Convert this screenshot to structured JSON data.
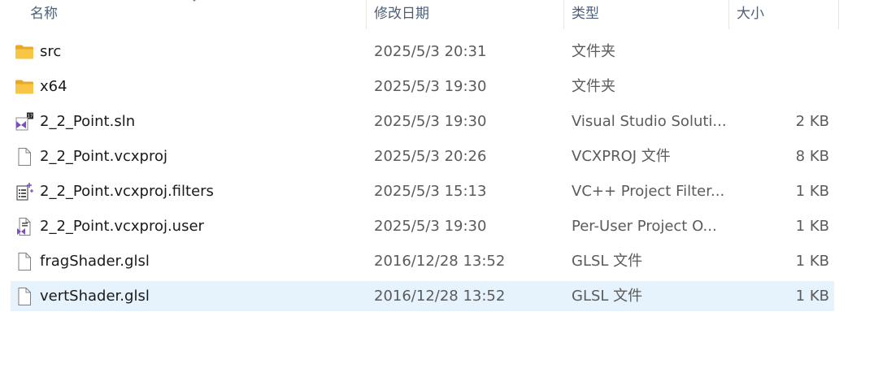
{
  "columns": {
    "name": "名称",
    "modified": "修改日期",
    "type": "类型",
    "size": "大小"
  },
  "files": [
    {
      "name": "src",
      "modified": "2025/5/3 20:31",
      "type": "文件夹",
      "size": "",
      "icon": "folder-icon"
    },
    {
      "name": "x64",
      "modified": "2025/5/3 19:30",
      "type": "文件夹",
      "size": "",
      "icon": "folder-icon"
    },
    {
      "name": "2_2_Point.sln",
      "modified": "2025/5/3 19:30",
      "type": "Visual Studio Soluti...",
      "size": "2 KB",
      "icon": "visual-studio-solution-icon"
    },
    {
      "name": "2_2_Point.vcxproj",
      "modified": "2025/5/3 20:26",
      "type": "VCXPROJ 文件",
      "size": "8 KB",
      "icon": "file-icon"
    },
    {
      "name": "2_2_Point.vcxproj.filters",
      "modified": "2025/5/3 15:13",
      "type": "VC++ Project Filter...",
      "size": "1 KB",
      "icon": "project-filters-icon"
    },
    {
      "name": "2_2_Point.vcxproj.user",
      "modified": "2025/5/3 19:30",
      "type": "Per-User Project O...",
      "size": "1 KB",
      "icon": "vs-user-file-icon"
    },
    {
      "name": "fragShader.glsl",
      "modified": "2016/12/28 13:52",
      "type": "GLSL 文件",
      "size": "1 KB",
      "icon": "file-icon"
    },
    {
      "name": "vertShader.glsl",
      "modified": "2016/12/28 13:52",
      "type": "GLSL 文件",
      "size": "1 KB",
      "icon": "file-icon",
      "selected": true
    }
  ],
  "colors": {
    "selection": "#e6f2fc",
    "folder": "#f8c645",
    "visual_studio": "#7b4fbf",
    "header_text": "#4c607a"
  }
}
